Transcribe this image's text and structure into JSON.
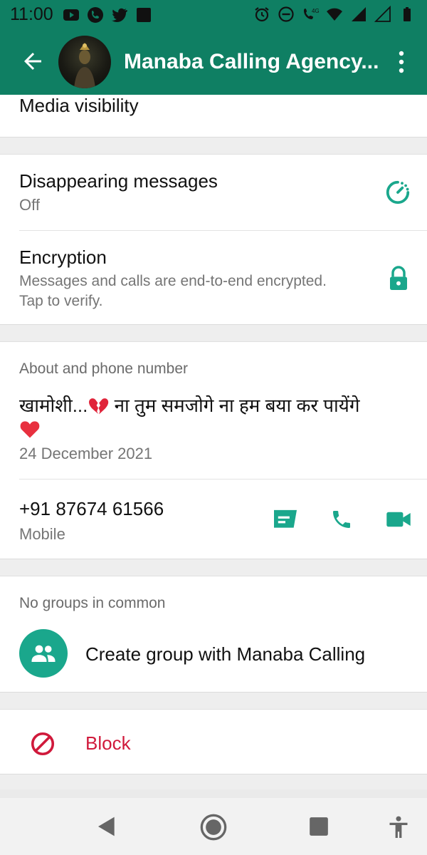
{
  "status_bar": {
    "time": "11:00",
    "icons": [
      "youtube-icon",
      "phone-call-icon",
      "twitter-icon",
      "square-app-icon",
      "alarm-icon",
      "do-not-disturb-icon",
      "volte-call-icon",
      "wifi-icon",
      "signal-icon",
      "signal-empty-icon",
      "battery-icon"
    ],
    "network": "4G"
  },
  "toolbar": {
    "title": "Manaba Calling Agency...",
    "back_icon": "back-arrow-icon",
    "menu_icon": "more-vert-icon"
  },
  "media": {
    "label": "Media visibility"
  },
  "disappearing": {
    "label": "Disappearing messages",
    "value": "Off",
    "icon": "timer-icon"
  },
  "encryption": {
    "label": "Encryption",
    "line1": "Messages and calls are end-to-end encrypted.",
    "line2": "Tap to verify.",
    "icon": "lock-icon"
  },
  "about": {
    "header": "About and phone number",
    "text_part1": "खामोशी...",
    "text_part2": "ना तुम समजोगे ना हम बया कर पायेंगे",
    "date": "24 December 2021",
    "phone": "+91 87674 61566",
    "phone_type": "Mobile"
  },
  "groups": {
    "header": "No groups in common",
    "create_label": "Create group with Manaba Calling"
  },
  "block": {
    "label": "Block"
  },
  "colors": {
    "primary": "#0f7f63",
    "accent": "#1aa78c",
    "danger": "#d0193b"
  }
}
